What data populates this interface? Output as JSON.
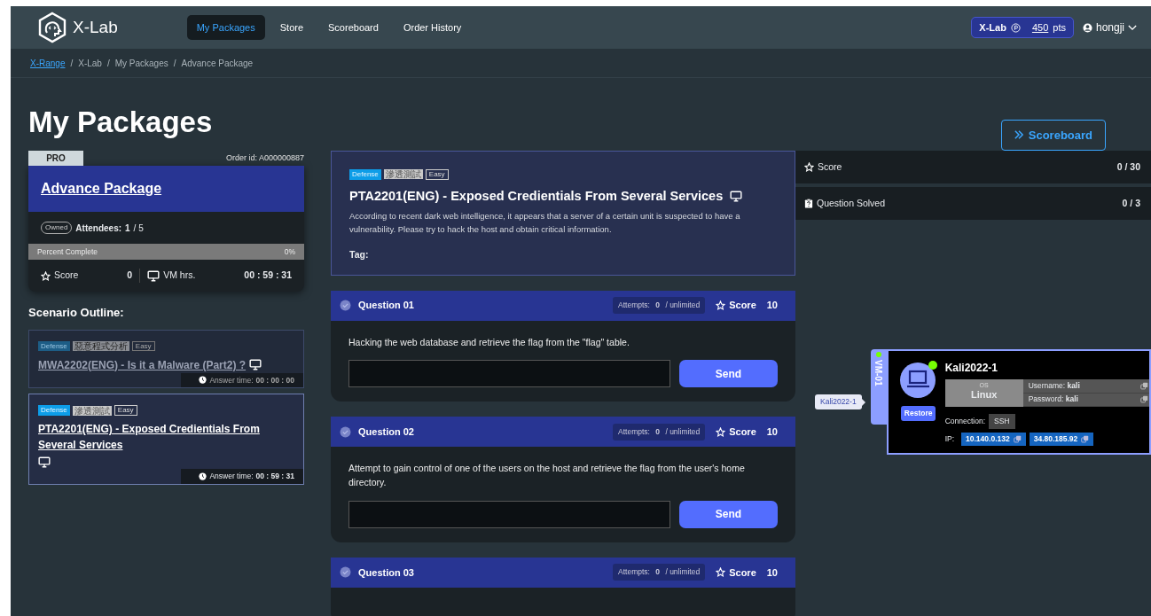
{
  "navbar": {
    "logo_text": "X-Lab",
    "nav_items": [
      {
        "label": "My Packages",
        "selected": true
      },
      {
        "label": "Store",
        "selected": false
      },
      {
        "label": "Scoreboard",
        "selected": false
      },
      {
        "label": "Order History",
        "selected": false
      }
    ],
    "points_badge": {
      "brand": "X-Lab",
      "points": "450",
      "unit": "pts"
    },
    "user": "hongji"
  },
  "breadcrumb": [
    {
      "label": "X-Range",
      "link": true
    },
    {
      "separator": "/",
      "label": "X-Lab",
      "link": false
    },
    {
      "separator": "/",
      "label": "My Packages",
      "link": false
    },
    {
      "separator": "/",
      "label": "Advance Package",
      "link": false
    }
  ],
  "page_title": "My Packages",
  "scoreboard_button": "Scoreboard",
  "package": {
    "tier": "PRO",
    "order_id": "Order id: A000000887",
    "name": "Advance Package",
    "owned_badge": "Owned",
    "attendees_label": "Attendees:",
    "attendees": "1",
    "attendees_total": "/ 5",
    "progress_label": "Percent Complete",
    "progress_text": "0%",
    "level": 0,
    "score_label": "Score",
    "score": "0",
    "vm_label": "VM hrs.",
    "vm_time": "00 : 59 : 31"
  },
  "scenario_outline": {
    "title": "Scenario Outline:",
    "items": [
      {
        "tags": [
          {
            "label": "Defense",
            "kind": "category"
          },
          {
            "label": "惡意程式分析",
            "kind": "topic"
          },
          {
            "label": "Easy",
            "kind": "level"
          }
        ],
        "title": "MWA2202(ENG) - Is it a Malware (Part2) ?",
        "answer_label": "Answer time:",
        "answer_time": "00 : 00 : 00",
        "selected": false
      },
      {
        "tags": [
          {
            "label": "Defense",
            "kind": "category"
          },
          {
            "label": "滲透測試",
            "kind": "topic"
          },
          {
            "label": "Easy",
            "kind": "level"
          }
        ],
        "title": "PTA2201(ENG) - Exposed Credientials From Several Services",
        "answer_label": "Answer time:",
        "answer_time": "00 : 59 : 31",
        "selected": true
      }
    ]
  },
  "challenge": {
    "tags": [
      {
        "label": "Defense",
        "kind": "category"
      },
      {
        "label": "滲透測試",
        "kind": "topic"
      },
      {
        "label": "Easy",
        "kind": "level"
      }
    ],
    "title": "PTA2201(ENG) - Exposed Credientials From Several Services",
    "description": "According to recent dark web intelligence, it appears that a server of a certain unit is suspected to have a vulnerability. Please try to hack the host and obtain critical information.",
    "tag_label": "Tag:"
  },
  "questions": [
    {
      "title": "Question 01",
      "solved": false,
      "attempts_label": "Attempts:",
      "attempts": "0",
      "attempts_limit": "/ unlimited",
      "score_label": "Score",
      "score": "10",
      "text": "Hacking the web database and retrieve the flag from the \"flag\" table.",
      "button": "Send"
    },
    {
      "title": "Question 02",
      "solved": false,
      "attempts_label": "Attempts:",
      "attempts": "0",
      "attempts_limit": "/ unlimited",
      "score_label": "Score",
      "score": "10",
      "text": "Attempt to gain control of one of the users on the host and retrieve the flag from the user's home directory.",
      "button": "Send"
    },
    {
      "title": "Question 03",
      "solved": false,
      "attempts_label": "Attempts:",
      "attempts": "0",
      "attempts_limit": "/ unlimited",
      "score_label": "Score",
      "score": "10"
    }
  ],
  "stats": [
    {
      "kind": "score",
      "label": "Score",
      "value": "0 / 30"
    },
    {
      "kind": "solved",
      "label": "Question Solved",
      "value": "0 / 3"
    }
  ],
  "vm": {
    "tooltip": "Kali2022-1",
    "tab_label": "VM-01",
    "online": true,
    "name": "Kali2022-1",
    "os_label": "OS",
    "os": "Linux",
    "username_label": "Username:",
    "username": "kali",
    "password_label": "Password:",
    "password": "kali",
    "restore_button": "Restore",
    "connection_label": "Connection:",
    "connection": "SSH",
    "ip_label": "IP:",
    "ips": [
      "10.140.0.132",
      "34.80.185.92"
    ]
  }
}
